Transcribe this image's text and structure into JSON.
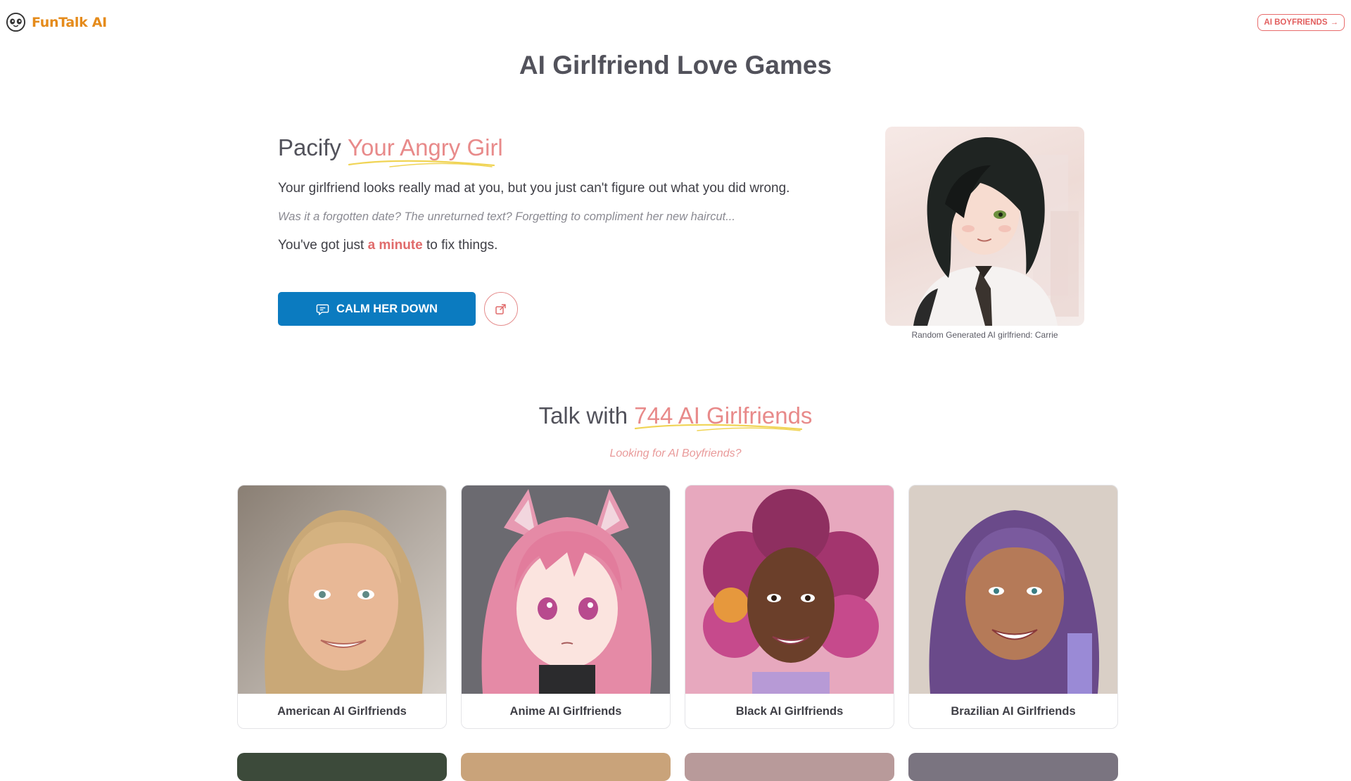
{
  "header": {
    "logo_text": "FunTalk AI",
    "nav_button": "AI BOYFRIENDS",
    "nav_arrow": "→"
  },
  "page_title": "AI Girlfriend Love Games",
  "hero": {
    "heading_plain": "Pacify ",
    "heading_highlight": "Your Angry Girl",
    "p1": "Your girlfriend looks really mad at you, but you just can't figure out what you did wrong.",
    "p2": "Was it a forgotten date? The unreturned text? Forgetting to compliment her new haircut...",
    "p3_before": "You've got just ",
    "p3_accent": "a minute",
    "p3_after": " to fix things.",
    "cta_label": "CALM HER DOWN",
    "portrait_caption": "Random Generated AI girlfriend: Carrie"
  },
  "section": {
    "heading_plain": "Talk with ",
    "heading_highlight": "744 AI Girlfriends",
    "subtitle": "Looking for AI Boyfriends?"
  },
  "cards": [
    {
      "label": "American AI Girlfriends"
    },
    {
      "label": "Anime AI Girlfriends"
    },
    {
      "label": "Black AI Girlfriends"
    },
    {
      "label": "Brazilian AI Girlfriends"
    }
  ],
  "colors": {
    "brand_orange": "#e58b1b",
    "accent_pink": "#e88a8a",
    "cta_blue": "#0b7bc0",
    "text_dark": "#3f3f46"
  },
  "icons": {
    "logo": "panda-face-icon",
    "cta": "chat-bubble-icon",
    "share": "share-icon",
    "nav": "arrow-right-icon"
  }
}
